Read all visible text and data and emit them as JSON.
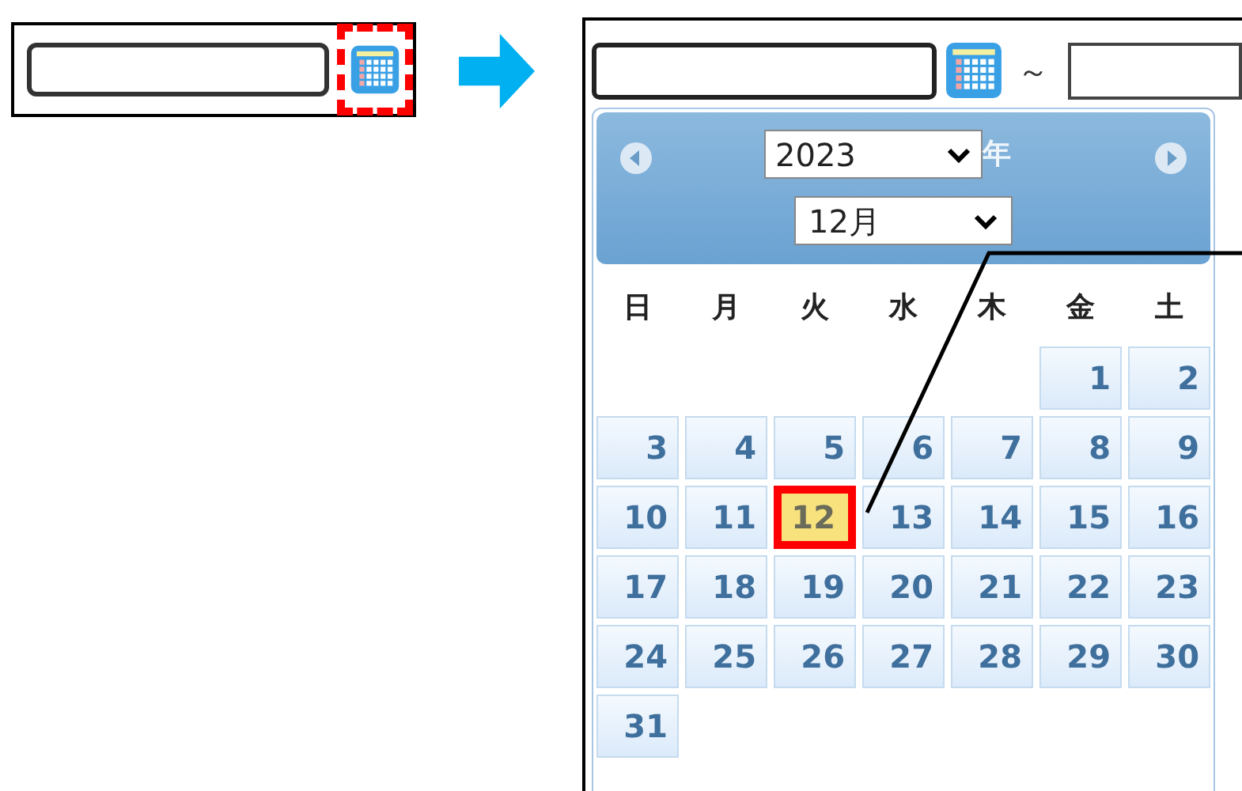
{
  "after": {
    "range_separator": "～",
    "year_select": {
      "value": "2023"
    },
    "year_suffix": "年",
    "month_select": {
      "value": "12月"
    },
    "weekdays": [
      "日",
      "月",
      "火",
      "水",
      "木",
      "金",
      "土"
    ],
    "weeks": [
      [
        {
          "kind": "empty"
        },
        {
          "kind": "empty"
        },
        {
          "kind": "empty"
        },
        {
          "kind": "empty"
        },
        {
          "kind": "empty"
        },
        {
          "kind": "day",
          "label": "1",
          "selected": false
        },
        {
          "kind": "day",
          "label": "2",
          "selected": false
        }
      ],
      [
        {
          "kind": "day",
          "label": "3",
          "selected": false
        },
        {
          "kind": "day",
          "label": "4",
          "selected": false
        },
        {
          "kind": "day",
          "label": "5",
          "selected": false
        },
        {
          "kind": "day",
          "label": "6",
          "selected": false
        },
        {
          "kind": "day",
          "label": "7",
          "selected": false
        },
        {
          "kind": "day",
          "label": "8",
          "selected": false
        },
        {
          "kind": "day",
          "label": "9",
          "selected": false
        }
      ],
      [
        {
          "kind": "day",
          "label": "10",
          "selected": false
        },
        {
          "kind": "day",
          "label": "11",
          "selected": false
        },
        {
          "kind": "day",
          "label": "12",
          "selected": true
        },
        {
          "kind": "day",
          "label": "13",
          "selected": false
        },
        {
          "kind": "day",
          "label": "14",
          "selected": false
        },
        {
          "kind": "day",
          "label": "15",
          "selected": false
        },
        {
          "kind": "day",
          "label": "16",
          "selected": false
        }
      ],
      [
        {
          "kind": "day",
          "label": "17",
          "selected": false
        },
        {
          "kind": "day",
          "label": "18",
          "selected": false
        },
        {
          "kind": "day",
          "label": "19",
          "selected": false
        },
        {
          "kind": "day",
          "label": "20",
          "selected": false
        },
        {
          "kind": "day",
          "label": "21",
          "selected": false
        },
        {
          "kind": "day",
          "label": "22",
          "selected": false
        },
        {
          "kind": "day",
          "label": "23",
          "selected": false
        }
      ],
      [
        {
          "kind": "day",
          "label": "24",
          "selected": false
        },
        {
          "kind": "day",
          "label": "25",
          "selected": false
        },
        {
          "kind": "day",
          "label": "26",
          "selected": false
        },
        {
          "kind": "day",
          "label": "27",
          "selected": false
        },
        {
          "kind": "day",
          "label": "28",
          "selected": false
        },
        {
          "kind": "day",
          "label": "29",
          "selected": false
        },
        {
          "kind": "day",
          "label": "30",
          "selected": false
        }
      ],
      [
        {
          "kind": "day",
          "label": "31",
          "selected": false
        }
      ]
    ]
  }
}
